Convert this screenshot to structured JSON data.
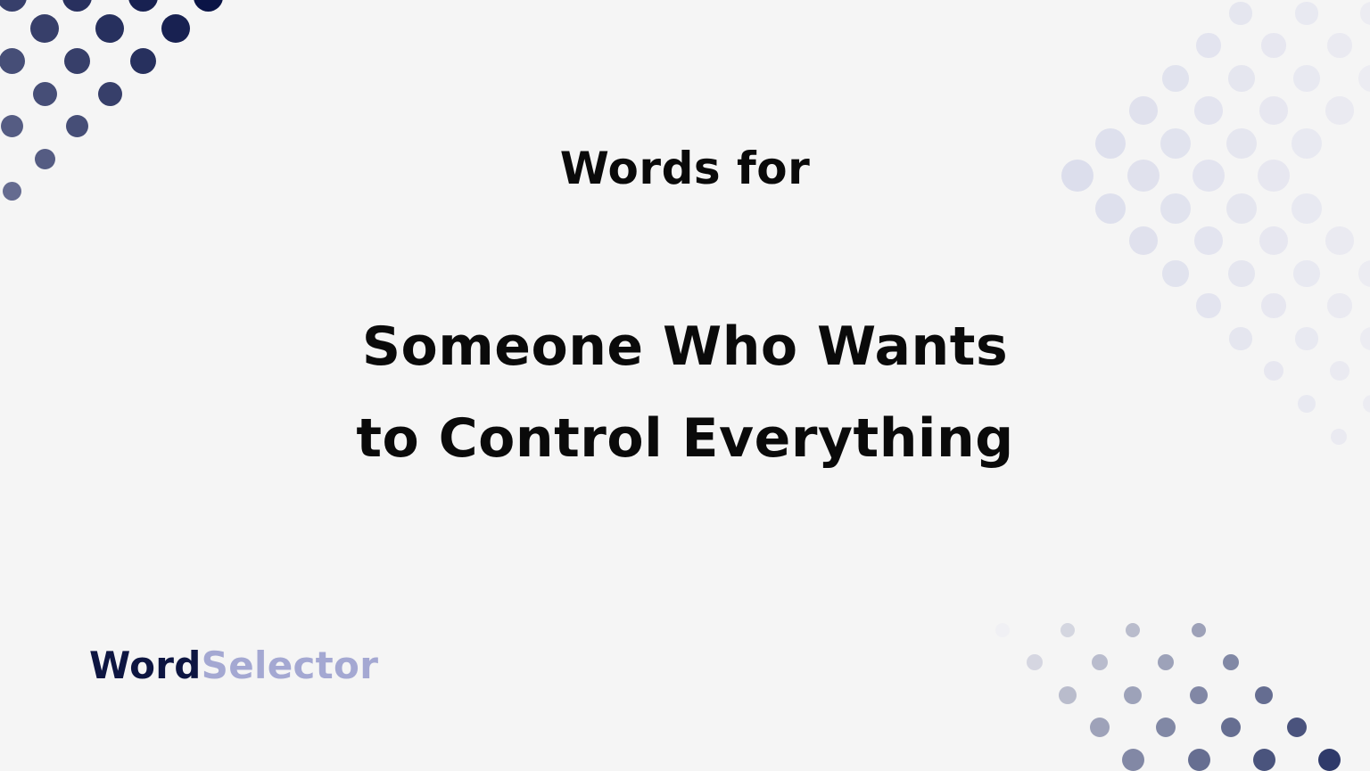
{
  "heading": {
    "pre_title": "Words for",
    "title_line1": "Someone Who Wants",
    "title_line2": "to Control Everything"
  },
  "logo": {
    "part1": "Word",
    "part2": "Selector"
  },
  "colors": {
    "background": "#f5f5f5",
    "text": "#0a0a0a",
    "brand_dark": "#0d1541",
    "brand_light": "#a4a8d2",
    "dots_light": "#e1e3ee"
  }
}
